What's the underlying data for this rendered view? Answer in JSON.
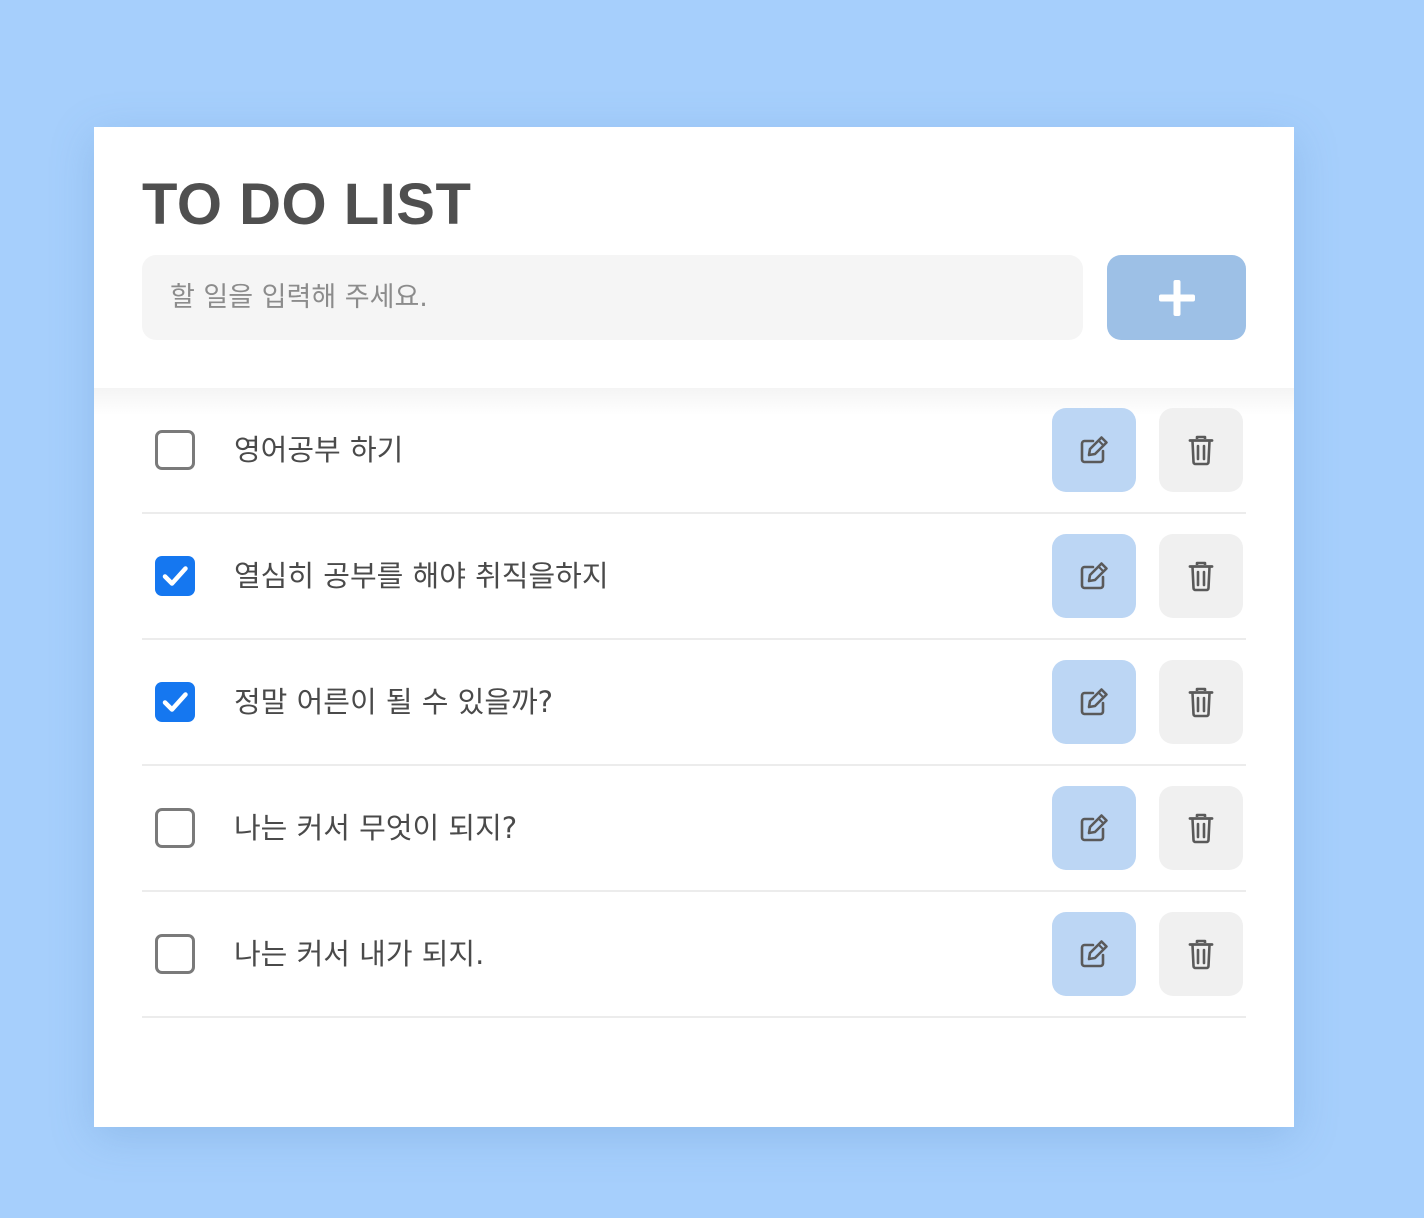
{
  "app": {
    "title": "TO DO LIST"
  },
  "input": {
    "placeholder": "할 일을 입력해 주세요.",
    "value": ""
  },
  "add_button": {
    "icon": "plus-icon"
  },
  "todos": [
    {
      "text": "영어공부 하기",
      "done": false
    },
    {
      "text": "열심히 공부를 해야 취직을하지",
      "done": true
    },
    {
      "text": "정말 어른이 될 수 있을까?",
      "done": true
    },
    {
      "text": "나는 커서 무엇이 되지?",
      "done": false
    },
    {
      "text": "나는 커서 내가 되지.",
      "done": false
    }
  ],
  "item_actions": {
    "edit_icon": "edit-icon",
    "delete_icon": "trash-icon"
  },
  "colors": {
    "background": "#a6cffc",
    "add_button": "#9dc0e6",
    "edit_button": "#bcd6f4",
    "delete_button": "#f0f0f0",
    "checkbox_checked": "#1577f0"
  }
}
